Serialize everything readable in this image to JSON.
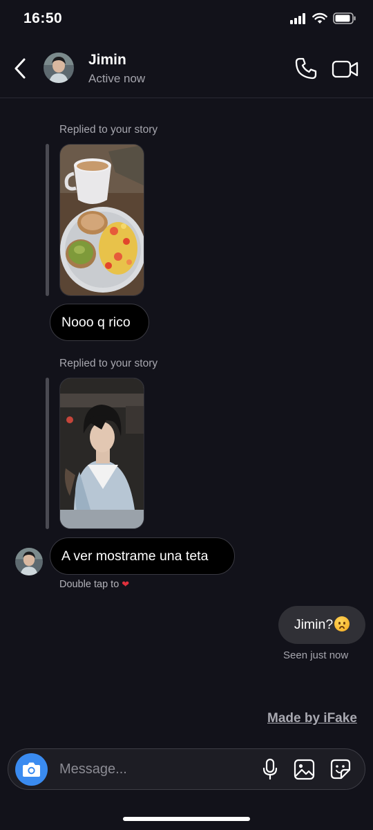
{
  "status_bar": {
    "time": "16:50"
  },
  "header": {
    "contact_name": "Jimin",
    "contact_status": "Active now"
  },
  "messages": [
    {
      "type": "story_reply",
      "label": "Replied to your story",
      "story": "breakfast-photo",
      "text": "Nooo q rico"
    },
    {
      "type": "story_reply",
      "label": "Replied to your story",
      "story": "person-photo",
      "text": "A ver mostrame una teta",
      "reaction_hint": "Double tap to"
    },
    {
      "type": "outgoing",
      "text": "Jimin?",
      "emoji": "frowning-face",
      "receipt": "Seen just now"
    }
  ],
  "watermark": "Made by iFake",
  "composer": {
    "placeholder": "Message..."
  },
  "colors": {
    "background": "#12121a",
    "camera_button": "#3a8bf0",
    "outgoing_bubble": "#303036",
    "heart": "#e0303c"
  }
}
